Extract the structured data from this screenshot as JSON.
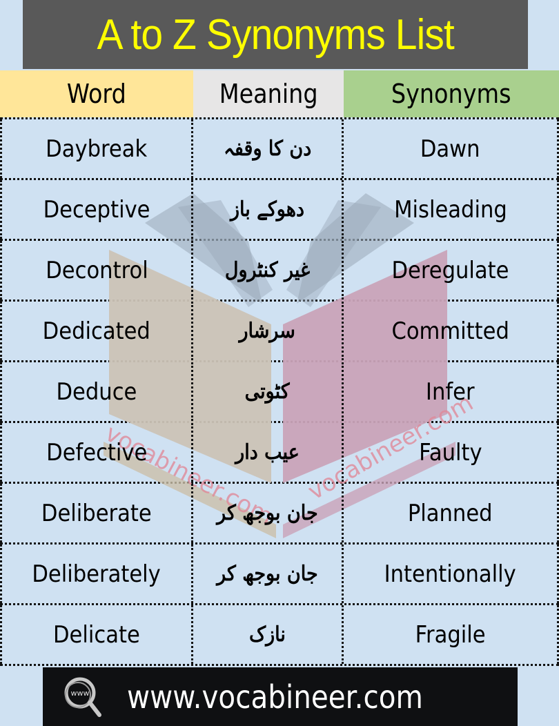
{
  "title": "A to Z Synonyms List",
  "headers": {
    "word": "Word",
    "meaning": "Meaning",
    "synonyms": "Synonyms"
  },
  "colors": {
    "title_bg": "#595959",
    "title_text": "#ffff00",
    "word_header": "#ffe699",
    "meaning_header": "#e7e6e6",
    "synonyms_header": "#a9d08e",
    "table_bg": "#cfe1f2",
    "footer_bg": "#0f1012"
  },
  "rows": [
    {
      "word": "Daybreak",
      "meaning": "دن کا وقفہ",
      "synonym": "Dawn"
    },
    {
      "word": "Deceptive",
      "meaning": "دھوکے باز",
      "synonym": "Misleading"
    },
    {
      "word": "Decontrol",
      "meaning": "غیر کنٹرول",
      "synonym": "Deregulate"
    },
    {
      "word": "Dedicated",
      "meaning": "سرشار",
      "synonym": "Committed"
    },
    {
      "word": "Deduce",
      "meaning": "کٹوتی",
      "synonym": "Infer"
    },
    {
      "word": "Defective",
      "meaning": "عیب دار",
      "synonym": "Faulty"
    },
    {
      "word": "Deliberate",
      "meaning": "جان بوجھ کر",
      "synonym": "Planned"
    },
    {
      "word": "Deliberately",
      "meaning": "جان بوجھ کر",
      "synonym": "Intentionally"
    },
    {
      "word": "Delicate",
      "meaning": "نازک",
      "synonym": "Fragile"
    }
  ],
  "watermark": {
    "text_left": "vocabineer.com",
    "text_right": "vocabineer.com",
    "icon": "open-book-logo"
  },
  "footer": {
    "icon": "www-search-icon",
    "icon_text": "www",
    "url": "www.vocabineer.com"
  }
}
